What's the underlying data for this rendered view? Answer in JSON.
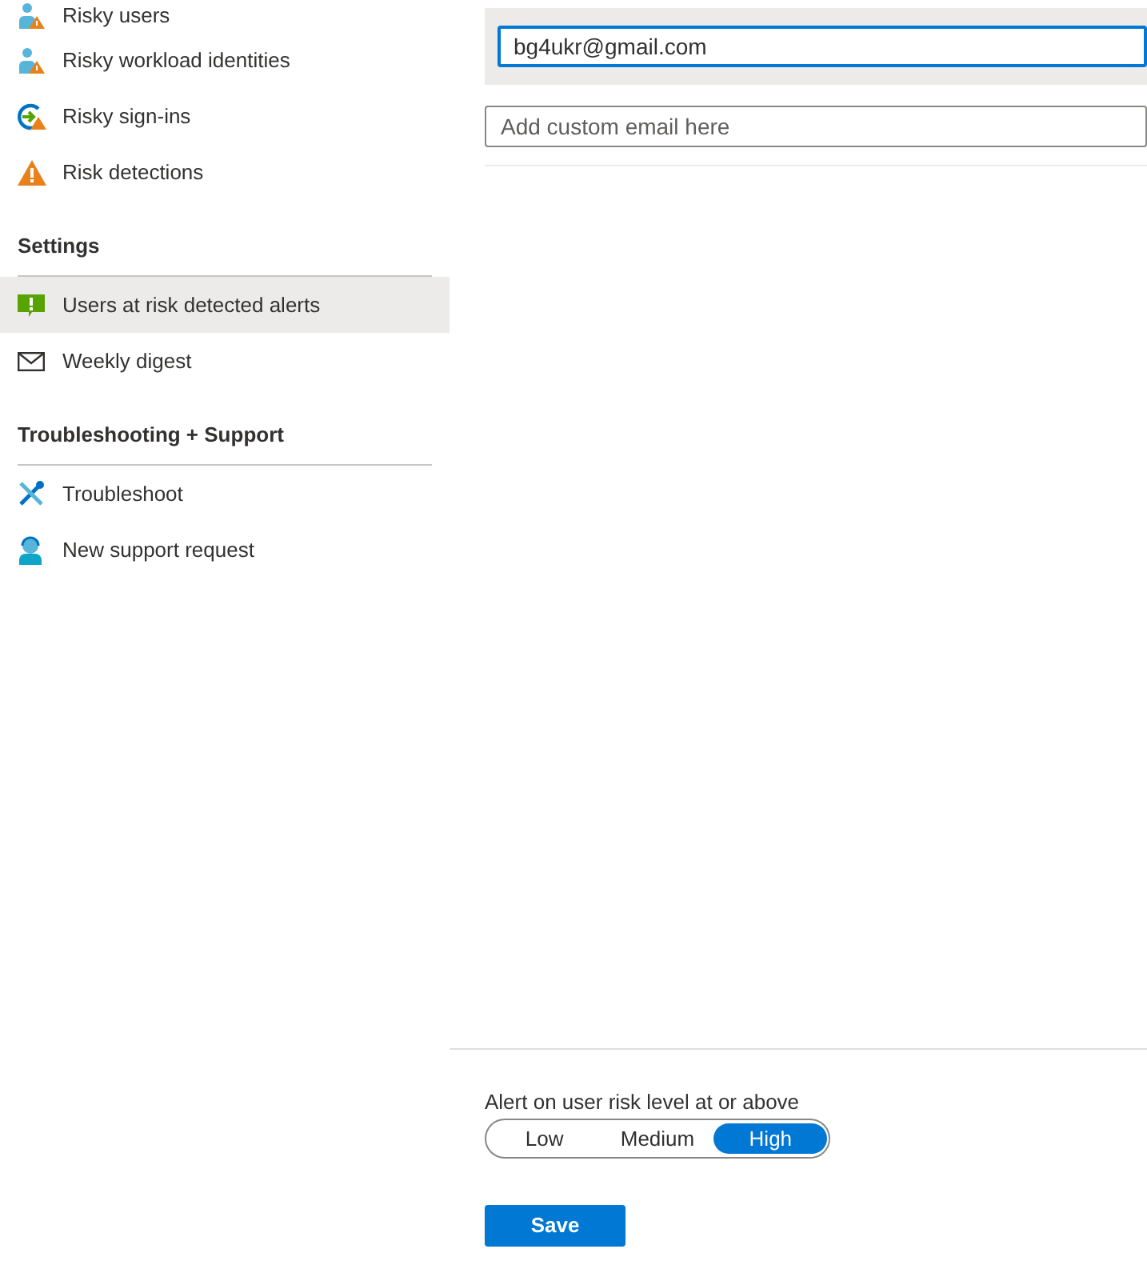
{
  "sidebar": {
    "groups": [
      {
        "items": [
          {
            "label": "Risky users",
            "kind": "user-warning",
            "selected": false
          },
          {
            "label": "Risky workload identities",
            "kind": "user-warning",
            "selected": false
          },
          {
            "label": "Risky sign-ins",
            "kind": "signin-warning",
            "selected": false
          },
          {
            "label": "Risk detections",
            "kind": "warning",
            "selected": false
          }
        ]
      },
      {
        "heading": "Settings",
        "items": [
          {
            "label": "Users at risk detected alerts",
            "kind": "alert",
            "selected": true
          },
          {
            "label": "Weekly digest",
            "kind": "mail",
            "selected": false
          }
        ]
      },
      {
        "heading": "Troubleshooting + Support",
        "items": [
          {
            "label": "Troubleshoot",
            "kind": "tools",
            "selected": false
          },
          {
            "label": "New support request",
            "kind": "support",
            "selected": false
          }
        ]
      }
    ]
  },
  "emails": [
    {
      "value": "bg4ukr@gmail.com"
    }
  ],
  "custom_email": {
    "placeholder": "Add custom email here"
  },
  "risk_level": {
    "label": "Alert on user risk level at or above",
    "options": [
      {
        "label": "Low",
        "selected": false
      },
      {
        "label": "Medium",
        "selected": false
      },
      {
        "label": "High",
        "selected": true
      }
    ]
  },
  "save_button": "Save"
}
